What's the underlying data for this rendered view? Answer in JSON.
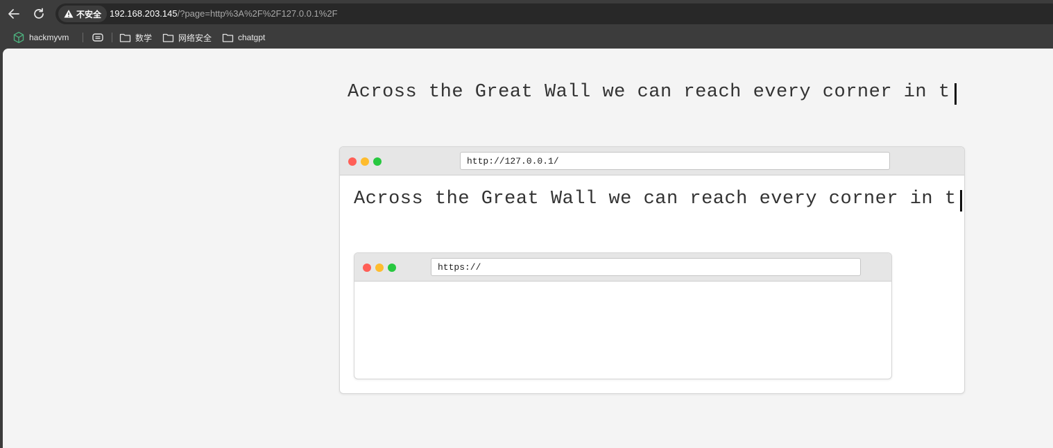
{
  "browser": {
    "security_label": "不安全",
    "url_host": "192.168.203.145",
    "url_rest": "/?page=http%3A%2F%2F127.0.0.1%2F",
    "bookmarks": [
      {
        "label": "hackmyvm",
        "icon": "hackmyvm-logo-icon"
      },
      {
        "label": "",
        "icon": "reading-list-icon"
      },
      {
        "label": "数学",
        "icon": "folder-icon"
      },
      {
        "label": "网络安全",
        "icon": "folder-icon"
      },
      {
        "label": "chatgpt",
        "icon": "folder-icon"
      }
    ]
  },
  "page": {
    "heading_text": "Across the Great Wall we can reach every corner in t",
    "frame1": {
      "url": "http://127.0.0.1/",
      "heading_text": "Across the Great Wall we can reach every corner in t",
      "frame2": {
        "url": "https://"
      }
    }
  },
  "colors": {
    "dot_red": "#ff5f57",
    "dot_yellow": "#febc2e",
    "dot_green": "#28c840",
    "page_background": "#f4f4f4"
  }
}
